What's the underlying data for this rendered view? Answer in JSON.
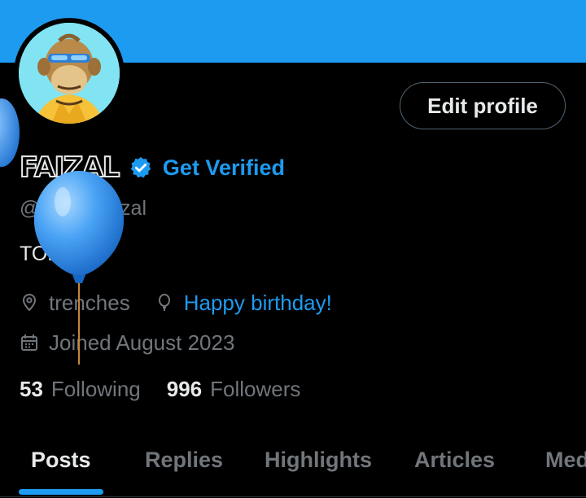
{
  "header": {
    "edit_profile_label": "Edit profile"
  },
  "profile": {
    "display_name": "FAIZAL",
    "get_verified": "Get Verified",
    "handle": "@AlphaFaizal",
    "bio": "TOP G.",
    "location": "trenches",
    "birthday": "Happy birthday!",
    "joined": "Joined August 2023"
  },
  "stats": {
    "following_count": "53",
    "following_label": "Following",
    "followers_count": "996",
    "followers_label": "Followers"
  },
  "tabs": [
    {
      "label": "Posts",
      "active": true
    },
    {
      "label": "Replies"
    },
    {
      "label": "Highlights"
    },
    {
      "label": "Articles"
    },
    {
      "label": "Media"
    }
  ],
  "colors": {
    "accent": "#1d9bf0",
    "background": "#000000",
    "text_primary": "#e7e9ea",
    "text_secondary": "#71767b",
    "border": "#536471"
  },
  "icons": {
    "verified": "verified-badge-icon",
    "location": "location-pin-icon",
    "birthday": "balloon-icon",
    "joined": "calendar-icon"
  }
}
